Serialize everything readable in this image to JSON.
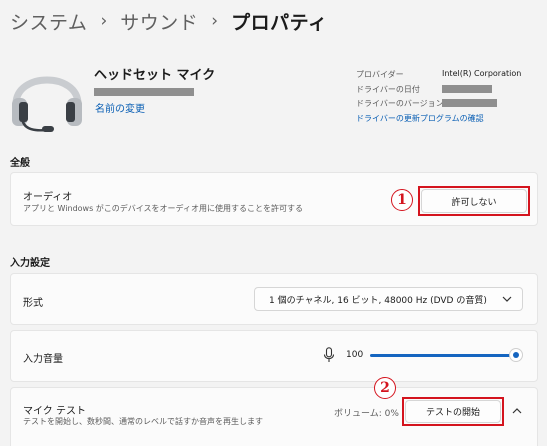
{
  "breadcrumb": {
    "items": [
      "システム",
      "サウンド"
    ],
    "current": "プロパティ"
  },
  "device": {
    "name": "ヘッドセット マイク",
    "rename_link": "名前の変更",
    "icon": "headset-icon"
  },
  "properties": {
    "provider_label": "プロバイダー",
    "provider_value": "Intel(R) Corporation",
    "driver_date_label": "ドライバーの日付",
    "driver_version_label": "ドライバーのバージョン",
    "driver_update_link": "ドライバーの更新プログラムの確認"
  },
  "general": {
    "section_title": "全般",
    "audio_title": "オーディオ",
    "audio_desc": "アプリと Windows がこのデバイスをオーディオ用に使用することを許可する",
    "disallow_button": "許可しない"
  },
  "input": {
    "section_title": "入力設定",
    "format_label": "形式",
    "format_value": "1 個のチャネル, 16 ビット, 48000 Hz (DVD の音質)",
    "volume_label": "入力音量",
    "volume_value": "100",
    "volume_level": 1.0
  },
  "mic_test": {
    "title": "マイク テスト",
    "desc": "テストを開始し、数秒間、通常のレベルで話すか音声を再生します",
    "volume_readout": "ボリューム: 0%",
    "start_button": "テストの開始"
  },
  "annotations": {
    "badge1": "1",
    "badge2": "2"
  },
  "colors": {
    "accent": "#1565c0",
    "link": "#0a5fb4",
    "highlight": "#d4141e"
  }
}
